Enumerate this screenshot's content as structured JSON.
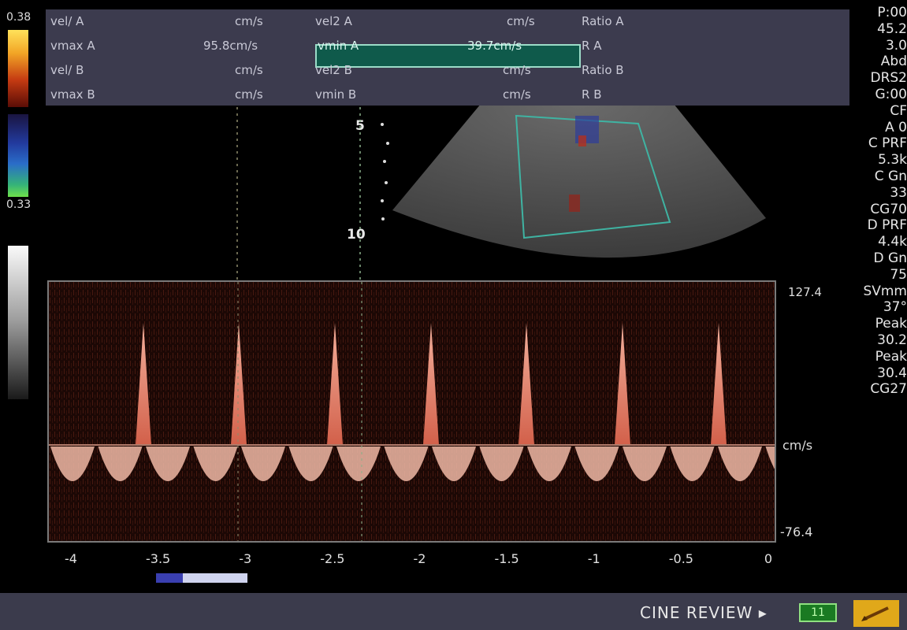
{
  "measurements": {
    "rows": [
      {
        "c1": "vel/ A",
        "c2": "cm/s",
        "c3": "vel2 A",
        "c4": "cm/s",
        "c5": "Ratio A"
      },
      {
        "c1": "vmax A",
        "c2": "95.8cm/s",
        "c3": "vmin A",
        "c4": "39.7cm/s",
        "c5": "R A"
      },
      {
        "c1": "vel/ B",
        "c2": "cm/s",
        "c3": "vel2 B",
        "c4": "cm/s",
        "c5": "Ratio B"
      },
      {
        "c1": "vmax B",
        "c2": "cm/s",
        "c3": "vmin B",
        "c4": "cm/s",
        "c5": "R B"
      }
    ]
  },
  "color_scale": {
    "top": "0.38",
    "bottom": "0.33"
  },
  "right_panel": [
    "P:00",
    "45.2",
    "3.0",
    "Abd",
    "DRS2",
    "G:00",
    "CF",
    "A 0",
    "C PRF",
    "5.3k",
    "C Gn",
    "33",
    "CG70",
    "D PRF",
    "4.4k",
    "D Gn",
    "75",
    "SVmm",
    "37°",
    "Peak",
    "30.2",
    "Peak",
    "30.4",
    "CG27"
  ],
  "depth_markers": [
    "5",
    "10"
  ],
  "spectral": {
    "scale_top": "127.4",
    "scale_unit": "cm/s",
    "scale_bottom": "-76.4",
    "time_ticks": [
      "-4",
      "-3.5",
      "-3",
      "-2.5",
      "-2",
      "-1.5",
      "-1",
      "-0.5",
      "0"
    ]
  },
  "bottom": {
    "cine_label": "CINE REVIEW ▸",
    "cine_box": "11"
  }
}
